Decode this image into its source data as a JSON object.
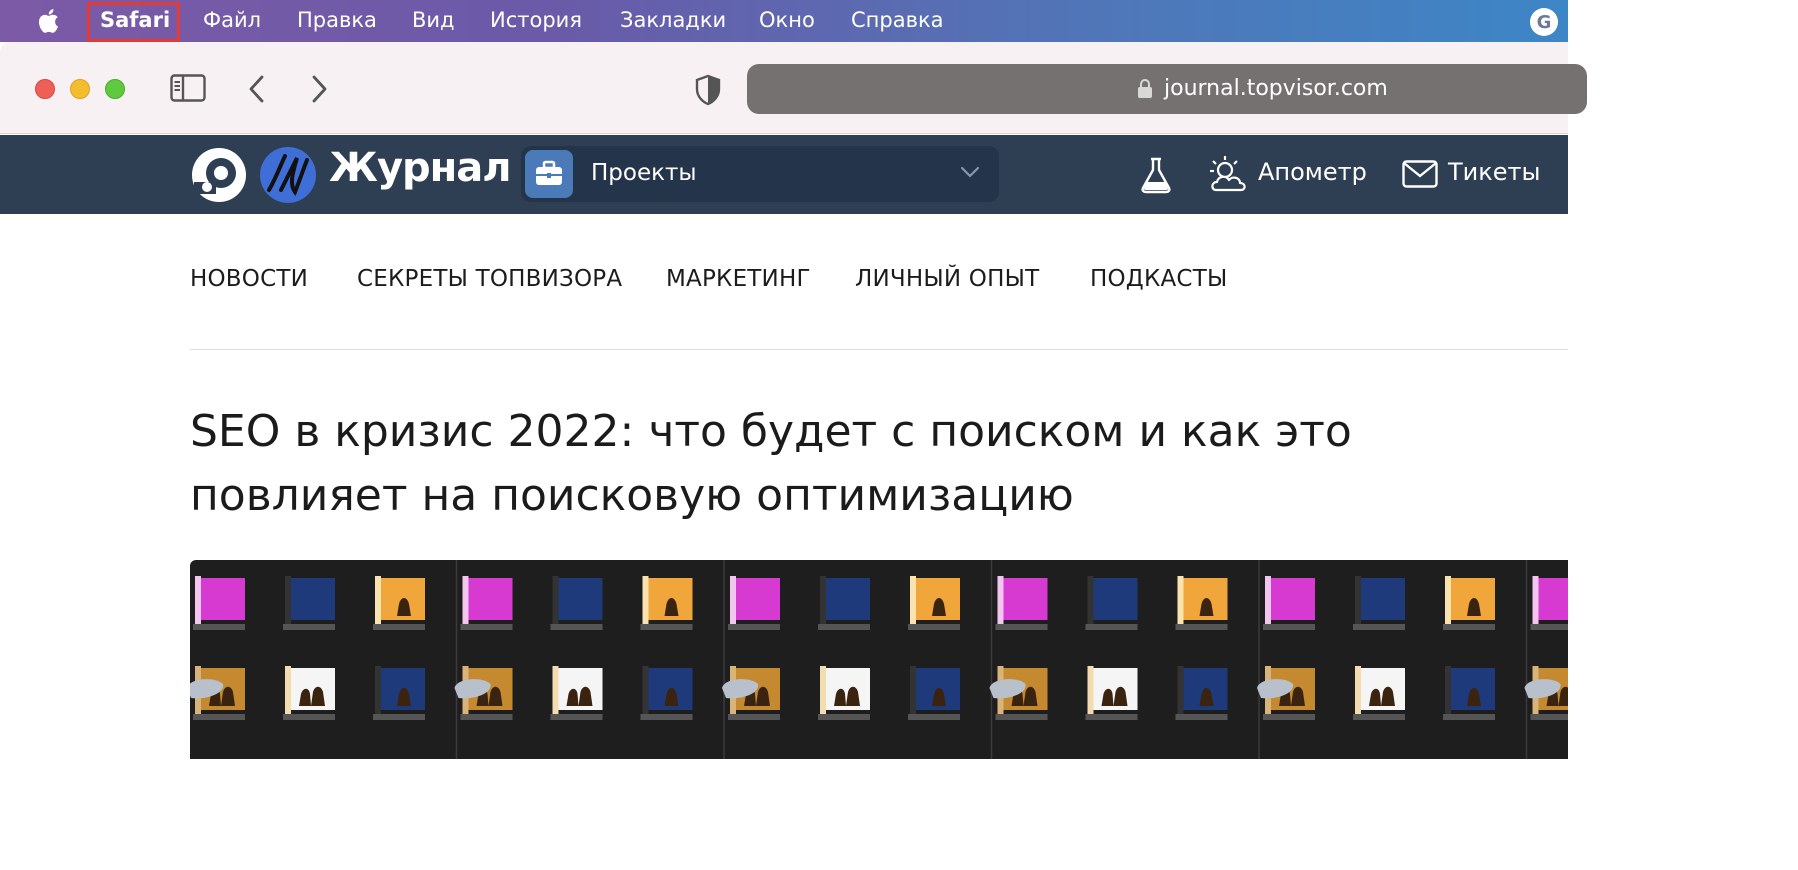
{
  "menubar": {
    "app": "Safari",
    "items": [
      "Файл",
      "Правка",
      "Вид",
      "История",
      "Закладки",
      "Окно",
      "Справка"
    ],
    "right_icon": "grammarly-icon"
  },
  "toolbar": {
    "url": "journal.topvisor.com",
    "icons": [
      "sidebar-icon",
      "back-icon",
      "forward-icon",
      "privacy-shield-icon",
      "lock-icon"
    ]
  },
  "site_header": {
    "logo_text": "Журнал",
    "projects_label": "Проекты",
    "apometer_label": "Апометр",
    "tickets_label": "Тикеты"
  },
  "nav": {
    "items": [
      "НОВОСТИ",
      "СЕКРЕТЫ ТОПВИЗОРА",
      "МАРКЕТИНГ",
      "ЛИЧНЫЙ ОПЫТ",
      "ПОДКАСТЫ"
    ]
  },
  "article": {
    "headline": "SEO в кризис 2022: что будет с поиском и как это повлияет на поисковую оптимизацию"
  },
  "colors": {
    "menubar_gradient_start": "#7c5aa6",
    "menubar_gradient_end": "#3d86c6",
    "site_header_bg": "#2e3f54",
    "highlight_box": "#e53935",
    "tile_magenta": "#d63ad0",
    "tile_navy": "#1f3a7a",
    "tile_orange": "#f0a63a"
  }
}
